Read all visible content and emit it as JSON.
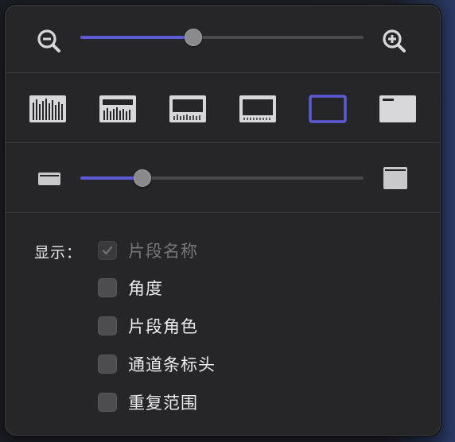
{
  "zoom": {
    "zoom_out_icon": "magnifier-minus-icon",
    "zoom_in_icon": "magnifier-plus-icon",
    "value": 0.4
  },
  "clip_appearance": {
    "options": [
      {
        "icon": "waveform-large-icon"
      },
      {
        "icon": "waveform-medium-icon"
      },
      {
        "icon": "waveform-small-icon"
      },
      {
        "icon": "filmstrip-waveform-small-icon"
      },
      {
        "icon": "filmstrip-only-icon",
        "selected": true
      },
      {
        "icon": "name-only-icon"
      }
    ],
    "selected_color": "#5b5bd6"
  },
  "clip_height": {
    "small_icon": "clip-height-small-icon",
    "large_icon": "clip-height-large-icon",
    "value": 0.22
  },
  "display": {
    "label": "显示：",
    "options": [
      {
        "label": "片段名称",
        "checked": true,
        "enabled": false
      },
      {
        "label": "角度",
        "checked": false,
        "enabled": true
      },
      {
        "label": "片段角色",
        "checked": false,
        "enabled": true
      },
      {
        "label": "通道条标头",
        "checked": false,
        "enabled": true
      },
      {
        "label": "重复范围",
        "checked": false,
        "enabled": true
      }
    ]
  }
}
